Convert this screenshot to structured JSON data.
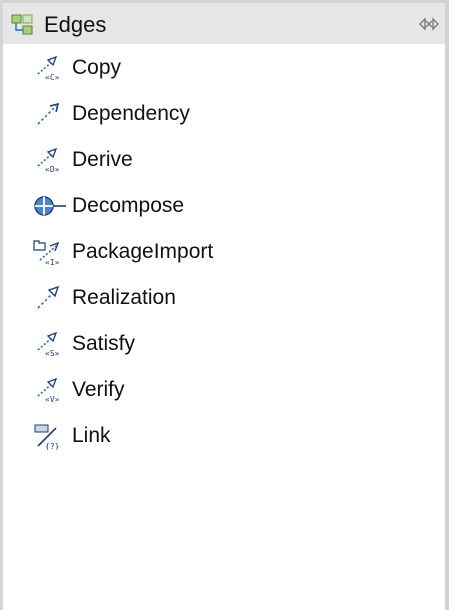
{
  "drawer": {
    "title": "Edges",
    "icon": "edge-palette-icon",
    "pin_icon": "pin-drawer-icon"
  },
  "tools": [
    {
      "label": "Copy",
      "icon": "copy-edge-icon",
      "stereo": "C"
    },
    {
      "label": "Dependency",
      "icon": "dependency-edge-icon"
    },
    {
      "label": "Derive",
      "icon": "derive-edge-icon",
      "stereo": "D"
    },
    {
      "label": "Decompose",
      "icon": "decompose-edge-icon"
    },
    {
      "label": "PackageImport",
      "icon": "package-import-edge-icon",
      "stereo": "I"
    },
    {
      "label": "Realization",
      "icon": "realization-edge-icon"
    },
    {
      "label": "Satisfy",
      "icon": "satisfy-edge-icon",
      "stereo": "S"
    },
    {
      "label": "Verify",
      "icon": "verify-edge-icon",
      "stereo": "V"
    },
    {
      "label": "Link",
      "icon": "link-edge-icon",
      "stereo": "?"
    }
  ],
  "colors": {
    "header_bg": "#e6e6e6",
    "icon_blue": "#2a6ab8",
    "icon_dark": "#1d3f75"
  }
}
